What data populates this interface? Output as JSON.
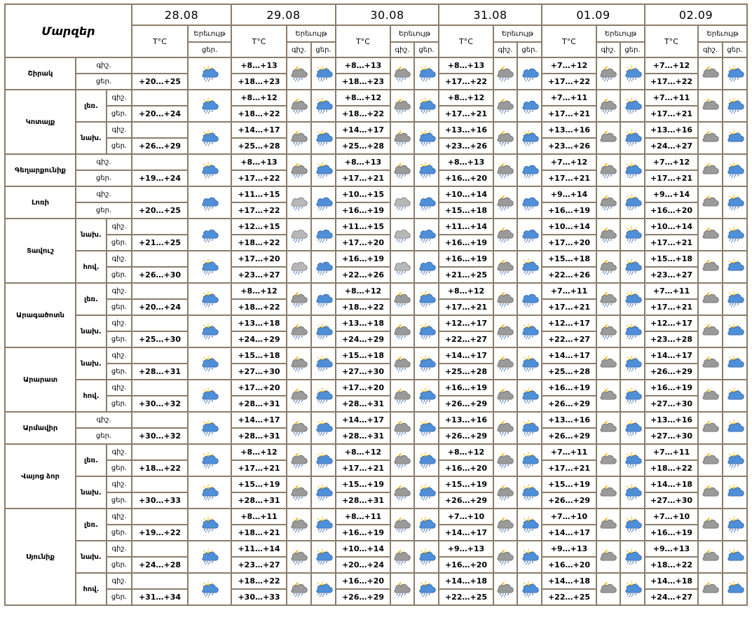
{
  "header": {
    "title": "Մարզեր",
    "dates": [
      "28.08",
      "29.08",
      "30.08",
      "31.08",
      "01.09",
      "02.09"
    ],
    "temp_label": "T°C",
    "phen_label": "Երեւույթ",
    "night_label": "գիշ.",
    "day_label": "ցեր."
  },
  "regions": [
    {
      "name": "Շիրակ",
      "zones": [
        {
          "zone": "",
          "t28": "+20…+25",
          "ic28": "cloud-sun-rain",
          "n": [
            "+8…+13",
            "+8…+13",
            "+8…+13",
            "+7…+12",
            "+7…+12"
          ],
          "d": [
            "+18…+23",
            "+18…+23",
            "+17…+22",
            "+17…+22",
            "+17…+22"
          ],
          "icn": [
            "moon-cloud-rain",
            "moon-cloud-rain",
            "moon-cloud-rain",
            "moon-cloud-rain",
            "moon-cloud"
          ],
          "icd": [
            "sun-cloud-rain",
            "sun-cloud-rain",
            "cloud-rain",
            "sun-cloud-rain",
            "sun-cloud-rain"
          ]
        }
      ]
    },
    {
      "name": "Կոտայք",
      "zones": [
        {
          "zone": "լեռ.",
          "t28": "+20…+24",
          "ic28": "cloud-sun-rain",
          "n": [
            "+8…+12",
            "+8…+12",
            "+8…+12",
            "+7…+11",
            "+7…+11"
          ],
          "d": [
            "+18…+22",
            "+18…+22",
            "+17…+21",
            "+17…+21",
            "+17…+21"
          ],
          "icn": [
            "moon-cloud-rain",
            "moon-cloud-rain",
            "moon-cloud-rain",
            "moon-cloud-rain",
            "moon-cloud"
          ],
          "icd": [
            "sun-cloud-rain",
            "sun-cloud-rain",
            "cloud-rain",
            "sun-cloud-rain",
            "sun-cloud-rain"
          ]
        },
        {
          "zone": "նախ.",
          "t28": "+26…+29",
          "ic28": "sun-cloud-rain",
          "n": [
            "+14…+17",
            "+14…+17",
            "+13…+16",
            "+13…+16",
            "+13…+16"
          ],
          "d": [
            "+25…+28",
            "+25…+28",
            "+23…+26",
            "+23…+26",
            "+24…+27"
          ],
          "icn": [
            "moon-cloud-rain",
            "moon-cloud-rain",
            "moon-cloud-rain",
            "moon-cloud",
            "moon-cloud"
          ],
          "icd": [
            "sun-cloud-rain",
            "sun-cloud-rain",
            "sun-cloud-rain",
            "sun-cloud-rain",
            "sun-cloud"
          ]
        }
      ]
    },
    {
      "name": "Գեղարքունիք",
      "zones": [
        {
          "zone": "",
          "t28": "+19…+24",
          "ic28": "cloud-sun-rain",
          "n": [
            "+8…+13",
            "+8…+13",
            "+8…+13",
            "+7…+12",
            "+7…+12"
          ],
          "d": [
            "+17…+22",
            "+17…+21",
            "+16…+20",
            "+17…+21",
            "+17…+21"
          ],
          "icn": [
            "moon-cloud-rain",
            "moon-cloud-rain",
            "moon-cloud-rain",
            "moon-cloud-rain",
            "moon-cloud"
          ],
          "icd": [
            "sun-cloud-rain",
            "sun-cloud-rain",
            "cloud-rain",
            "sun-cloud-rain",
            "sun-cloud-rain"
          ]
        }
      ]
    },
    {
      "name": "Լոռի",
      "zones": [
        {
          "zone": "",
          "t28": "+20…+25",
          "ic28": "cloud-rain",
          "n": [
            "+11…+15",
            "+10…+15",
            "+10…+14",
            "+9…+14",
            "+9…+14"
          ],
          "d": [
            "+17…+22",
            "+16…+19",
            "+15…+18",
            "+16…+19",
            "+16…+20"
          ],
          "icn": [
            "grey-cloud-rain",
            "grey-cloud-rain",
            "moon-cloud-rain",
            "moon-cloud-rain",
            "moon-cloud"
          ],
          "icd": [
            "cloud-rain",
            "cloud-rain",
            "cloud-rain",
            "sun-cloud-rain",
            "sun-cloud-rain"
          ]
        }
      ]
    },
    {
      "name": "Տավուշ",
      "zones": [
        {
          "zone": "նախ.",
          "t28": "+21…+25",
          "ic28": "cloud-rain",
          "n": [
            "+12…+15",
            "+11…+15",
            "+11…+14",
            "+10…+14",
            "+10…+14"
          ],
          "d": [
            "+18…+22",
            "+17…+20",
            "+16…+19",
            "+17…+20",
            "+17…+21"
          ],
          "icn": [
            "grey-cloud-rain",
            "grey-cloud-rain",
            "moon-cloud-rain",
            "moon-cloud-rain",
            "moon-cloud"
          ],
          "icd": [
            "cloud-rain",
            "cloud-rain",
            "cloud-rain",
            "sun-cloud-rain",
            "sun-cloud-rain"
          ]
        },
        {
          "zone": "հով.",
          "t28": "+26…+30",
          "ic28": "sun-cloud-rain",
          "n": [
            "+17…+20",
            "+16…+19",
            "+16…+19",
            "+15…+18",
            "+15…+18"
          ],
          "d": [
            "+23…+27",
            "+22…+26",
            "+21…+25",
            "+22…+26",
            "+23…+27"
          ],
          "icn": [
            "grey-cloud-rain",
            "grey-cloud-rain",
            "moon-cloud-rain",
            "moon-cloud-rain",
            "moon-cloud"
          ],
          "icd": [
            "cloud-rain",
            "cloud-rain",
            "sun-cloud-rain",
            "sun-cloud-rain",
            "sun-cloud"
          ]
        }
      ]
    },
    {
      "name": "Արագածոտն",
      "zones": [
        {
          "zone": "լեռ.",
          "t28": "+20…+24",
          "ic28": "cloud-sun-rain",
          "n": [
            "+8…+12",
            "+8…+12",
            "+8…+12",
            "+7…+11",
            "+7…+11"
          ],
          "d": [
            "+18…+22",
            "+18…+22",
            "+17…+21",
            "+17…+21",
            "+17…+21"
          ],
          "icn": [
            "moon-cloud-rain",
            "moon-cloud-rain",
            "moon-cloud-rain",
            "moon-cloud-rain",
            "moon-cloud"
          ],
          "icd": [
            "cloud-rain",
            "sun-cloud-rain",
            "cloud-rain",
            "sun-cloud-rain",
            "sun-cloud-rain"
          ]
        },
        {
          "zone": "նախ.",
          "t28": "+25…+30",
          "ic28": "sun-cloud-rain",
          "n": [
            "+13…+18",
            "+13…+18",
            "+12…+17",
            "+12…+17",
            "+12…+17"
          ],
          "d": [
            "+24…+29",
            "+24…+29",
            "+22…+27",
            "+22…+27",
            "+23…+28"
          ],
          "icn": [
            "moon-cloud-rain",
            "moon-cloud-rain",
            "moon-cloud-rain",
            "moon-cloud-rain",
            "moon-cloud"
          ],
          "icd": [
            "sun-cloud-rain",
            "sun-cloud-rain",
            "sun-cloud-rain",
            "sun-cloud-rain",
            "sun-cloud"
          ]
        }
      ]
    },
    {
      "name": "Արարատ",
      "zones": [
        {
          "zone": "նախ.",
          "t28": "+28…+31",
          "ic28": "sun-cloud-rain",
          "n": [
            "+15…+18",
            "+15…+18",
            "+14…+17",
            "+14…+17",
            "+14…+17"
          ],
          "d": [
            "+27…+30",
            "+27…+30",
            "+25…+28",
            "+25…+28",
            "+26…+29"
          ],
          "icn": [
            "moon-cloud-rain",
            "moon-cloud-rain",
            "moon-cloud-rain",
            "moon-cloud",
            "moon-cloud"
          ],
          "icd": [
            "sun-cloud-rain",
            "sun-cloud-rain",
            "sun-cloud-rain",
            "sun-cloud-rain",
            "sun-cloud"
          ]
        },
        {
          "zone": "հով.",
          "t28": "+30…+32",
          "ic28": "sun-cloud-rain",
          "n": [
            "+17…+20",
            "+17…+20",
            "+16…+19",
            "+16…+19",
            "+16…+19"
          ],
          "d": [
            "+28…+31",
            "+28…+31",
            "+26…+29",
            "+26…+29",
            "+27…+30"
          ],
          "icn": [
            "moon-cloud-rain",
            "moon-cloud-rain",
            "moon-cloud-rain",
            "moon-cloud",
            "moon-cloud"
          ],
          "icd": [
            "sun-cloud-rain",
            "sun-cloud-rain",
            "sun-cloud-rain",
            "sun-cloud-rain",
            "sun-cloud"
          ]
        }
      ]
    },
    {
      "name": "Արմավիր",
      "zones": [
        {
          "zone": "",
          "t28": "+30…+32",
          "ic28": "sun-cloud-rain",
          "n": [
            "+14…+17",
            "+14…+17",
            "+13…+16",
            "+13…+16",
            "+13…+16"
          ],
          "d": [
            "+28…+31",
            "+28…+31",
            "+26…+29",
            "+26…+29",
            "+27…+30"
          ],
          "icn": [
            "moon-cloud-rain",
            "moon-cloud-rain",
            "moon-cloud-rain",
            "moon-cloud",
            "moon-cloud"
          ],
          "icd": [
            "sun-cloud-rain",
            "sun-cloud-rain",
            "sun-cloud-rain",
            "sun-cloud-rain",
            "sun-cloud"
          ]
        }
      ]
    },
    {
      "name": "Վայոց ձոր",
      "zones": [
        {
          "zone": "լեռ.",
          "t28": "+18…+22",
          "ic28": "sun-cloud-rain",
          "n": [
            "+8…+12",
            "+8…+12",
            "+8…+12",
            "+7…+11",
            "+7…+11"
          ],
          "d": [
            "+17…+21",
            "+17…+21",
            "+16…+20",
            "+17…+21",
            "+18…+22"
          ],
          "icn": [
            "moon-cloud-rain",
            "moon-cloud-rain",
            "moon-cloud-rain",
            "moon-cloud",
            "moon-cloud"
          ],
          "icd": [
            "sun-cloud-rain",
            "sun-cloud-rain",
            "sun-cloud-rain",
            "sun-cloud-rain",
            "sun-cloud-rain"
          ]
        },
        {
          "zone": "նախ.",
          "t28": "+30…+33",
          "ic28": "sun-cloud-rain",
          "n": [
            "+15…+19",
            "+15…+19",
            "+15…+19",
            "+15…+19",
            "+14…+18"
          ],
          "d": [
            "+28…+31",
            "+28…+31",
            "+26…+29",
            "+26…+29",
            "+27…+30"
          ],
          "icn": [
            "moon-cloud-rain",
            "moon-cloud-rain",
            "moon-cloud-rain",
            "moon-cloud",
            "moon-cloud"
          ],
          "icd": [
            "sun-cloud-rain",
            "sun-cloud-rain",
            "sun-cloud-rain",
            "sun-cloud-rain",
            "sun-cloud"
          ]
        }
      ]
    },
    {
      "name": "Սյունիք",
      "zones": [
        {
          "zone": "լեռ.",
          "t28": "+19…+22",
          "ic28": "sun-cloud-rain",
          "n": [
            "+8…+11",
            "+8…+11",
            "+7…+10",
            "+7…+10",
            "+7…+10"
          ],
          "d": [
            "+18…+21",
            "+16…+19",
            "+14…+17",
            "+14…+17",
            "+16…+19"
          ],
          "icn": [
            "moon-cloud-rain",
            "moon-cloud-rain",
            "moon-cloud-rain",
            "moon-cloud",
            "moon-cloud"
          ],
          "icd": [
            "sun-cloud-rain",
            "sun-cloud-rain",
            "sun-cloud-rain",
            "sun-cloud-rain",
            "sun-cloud-rain"
          ]
        },
        {
          "zone": "նախ.",
          "t28": "+24…+28",
          "ic28": "sun-cloud-rain",
          "n": [
            "+11…+14",
            "+10…+14",
            "+9…+13",
            "+9…+13",
            "+9…+13"
          ],
          "d": [
            "+23…+27",
            "+20…+24",
            "+16…+20",
            "+16…+20",
            "+18…+22"
          ],
          "icn": [
            "moon-cloud-rain",
            "moon-cloud-rain",
            "moon-cloud-rain",
            "moon-cloud",
            "moon-cloud"
          ],
          "icd": [
            "sun-cloud-rain",
            "sun-cloud-rain",
            "sun-cloud-rain",
            "sun-cloud-rain",
            "sun-cloud"
          ]
        },
        {
          "zone": "հով.",
          "t28": "+31…+34",
          "ic28": "sun-cloud-rain",
          "n": [
            "+18…+22",
            "+16…+20",
            "+14…+18",
            "+14…+18",
            "+14…+18"
          ],
          "d": [
            "+30…+33",
            "+26…+29",
            "+22…+25",
            "+22…+25",
            "+24…+27"
          ],
          "icn": [
            "moon-cloud-rain",
            "moon-cloud-rain",
            "moon-cloud-rain",
            "moon-cloud",
            "moon-cloud"
          ],
          "icd": [
            "sun-cloud-rain",
            "sun-cloud-rain",
            "sun-cloud-rain",
            "sun-cloud-rain",
            "sun-cloud"
          ]
        }
      ]
    }
  ]
}
